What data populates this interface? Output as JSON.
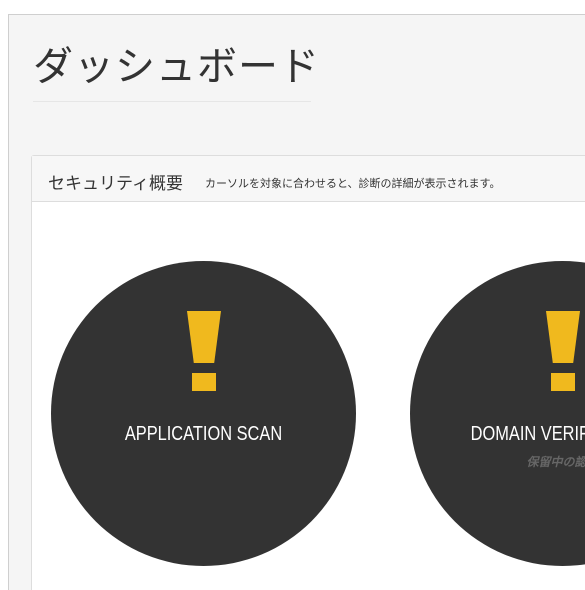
{
  "page": {
    "title": "ダッシュボード"
  },
  "security_panel": {
    "title": "セキュリティ概要",
    "hint": "カーソルを対象に合わせると、診断の詳細が表示されます。"
  },
  "status_cards": [
    {
      "label": "APPLICATION SCAN",
      "status": "warning",
      "icon": "exclamation-icon"
    },
    {
      "label": "DOMAIN VERIFICATION",
      "sublabel": "保留中の認証",
      "status": "warning",
      "icon": "exclamation-icon"
    }
  ],
  "colors": {
    "circle_bg": "#333333",
    "warning_accent": "#f0b91e",
    "page_bg": "#f5f5f5"
  }
}
